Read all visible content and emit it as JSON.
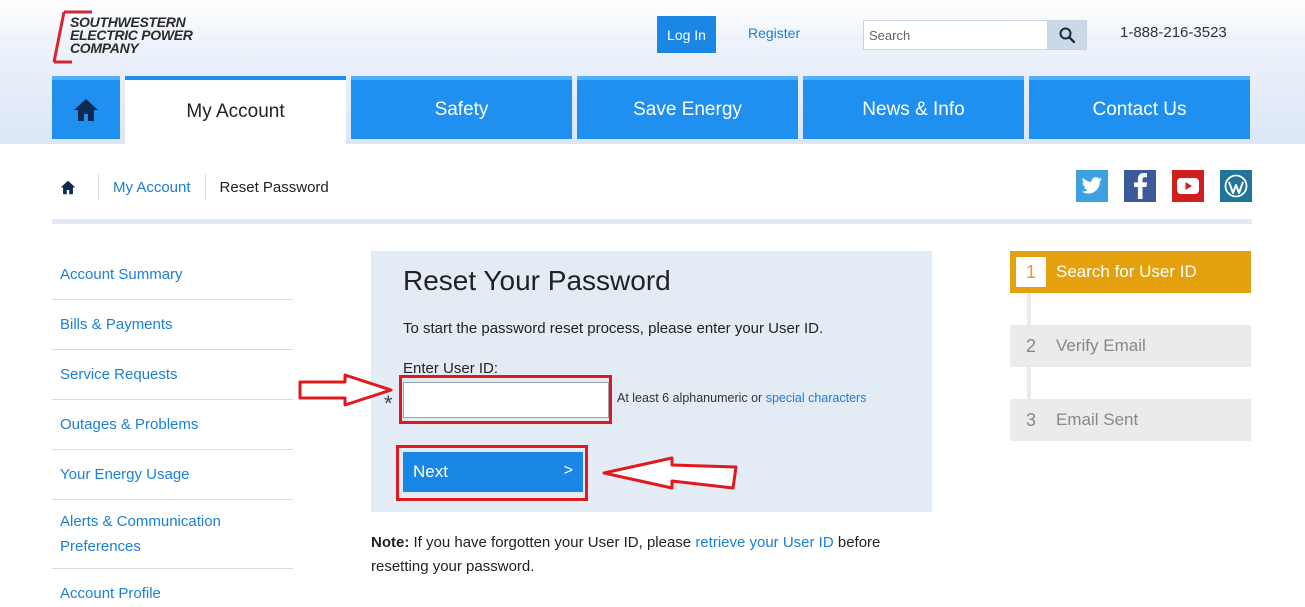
{
  "header": {
    "logo_lines": [
      "SOUTHWESTERN",
      "ELECTRIC POWER",
      "COMPANY"
    ],
    "login_label": "Log In",
    "register_label": "Register",
    "search_placeholder": "Search",
    "phone": "1-888-216-3523"
  },
  "nav": {
    "items": [
      {
        "label": "My Account"
      },
      {
        "label": "Safety"
      },
      {
        "label": "Save Energy"
      },
      {
        "label": "News & Info"
      },
      {
        "label": "Contact Us"
      }
    ]
  },
  "breadcrumb": {
    "link": "My Account",
    "current": "Reset Password"
  },
  "social": [
    {
      "icon": "twitter-icon",
      "color": "#3da0e0"
    },
    {
      "icon": "facebook-icon",
      "color": "#3b5a9a"
    },
    {
      "icon": "youtube-icon",
      "color": "#d11f1f"
    },
    {
      "icon": "wordpress-icon",
      "color": "#21759b"
    }
  ],
  "sidebar": {
    "items": [
      {
        "label": "Account Summary"
      },
      {
        "label": "Bills & Payments"
      },
      {
        "label": "Service Requests"
      },
      {
        "label": "Outages & Problems"
      },
      {
        "label": "Your Energy Usage"
      },
      {
        "label": "Alerts & Communication Preferences"
      },
      {
        "label": "Account Profile"
      }
    ]
  },
  "form": {
    "title": "Reset Your Password",
    "intro": "To start the password reset process, please enter your User ID.",
    "field_label": "Enter User ID:",
    "required_mark": "*",
    "input_value": "",
    "hint_text": "At least 6 alphanumeric or",
    "hint_link": "special characters",
    "next_label": "Next",
    "next_chevron": ">"
  },
  "note": {
    "bold": "Note:",
    "text_before": " If you have forgotten your User ID, please ",
    "link": "retrieve your User ID",
    "text_after": " before resetting your password."
  },
  "steps": [
    {
      "number": "1",
      "label": "Search for User ID",
      "state": "active"
    },
    {
      "number": "2",
      "label": "Verify Email",
      "state": "inactive"
    },
    {
      "number": "3",
      "label": "Email Sent",
      "state": "inactive"
    }
  ],
  "colors": {
    "brand_blue": "#1f8ff0",
    "link_blue": "#1a7fd6",
    "step_active": "#e5a10d",
    "highlight_red": "#e2181f"
  }
}
